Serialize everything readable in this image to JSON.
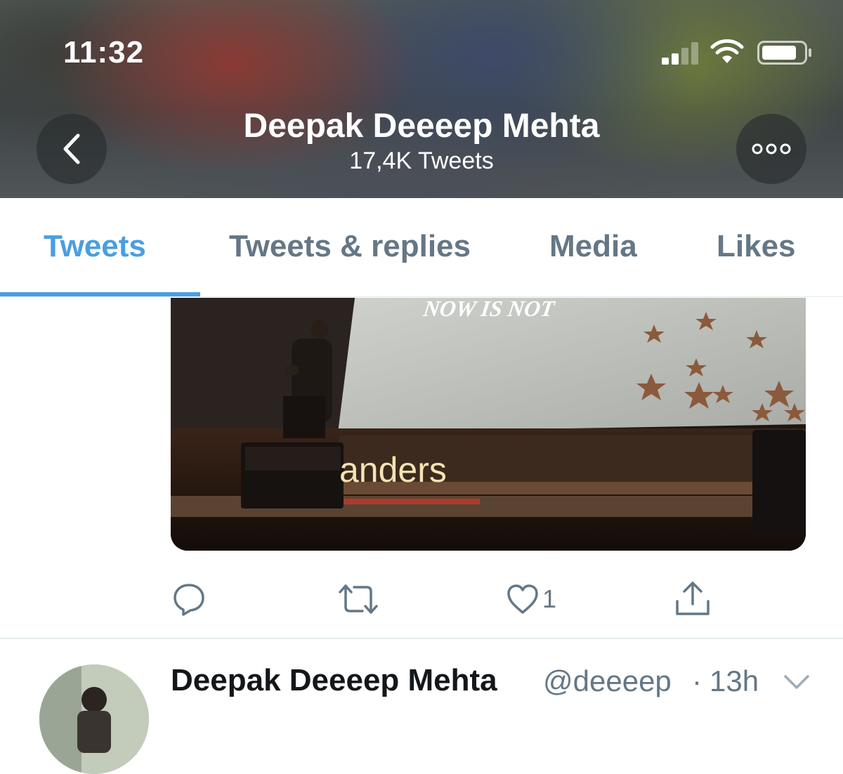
{
  "status_bar": {
    "time": "11:32"
  },
  "header": {
    "name": "Deepak Deeeep Mehta",
    "tweet_count": "17,4K Tweets"
  },
  "tabs": [
    {
      "label": "Tweets",
      "active": true
    },
    {
      "label": "Tweets & replies",
      "active": false
    },
    {
      "label": "Media",
      "active": false
    },
    {
      "label": "Likes",
      "active": false
    }
  ],
  "media": {
    "stage_sign": "anders",
    "screen_text": "NOW IS NOT"
  },
  "actions": {
    "like_count": "1",
    "icons": [
      "reply-icon",
      "retweet-icon",
      "like-icon",
      "share-icon"
    ]
  },
  "next_tweet": {
    "author": "Deepak Deeeep Mehta",
    "handle": "@deeeep",
    "separator": "·",
    "time": "13h"
  },
  "colors": {
    "accent": "#4a9fe0",
    "secondary_text": "#657786",
    "primary_text": "#14171a"
  }
}
